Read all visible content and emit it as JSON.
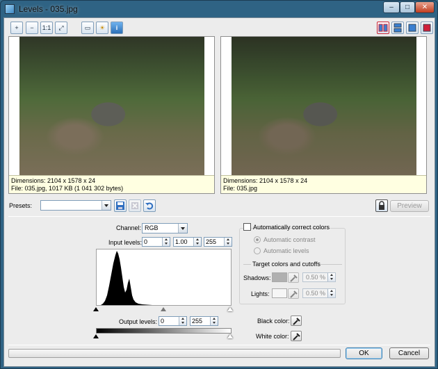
{
  "window": {
    "title": "Levels - 035.jpg",
    "buttons": [
      "–",
      "□",
      "✕"
    ]
  },
  "toolbar": {
    "left": [
      {
        "name": "zoom-in-icon",
        "glyph": "+"
      },
      {
        "name": "zoom-out-icon",
        "glyph": "−"
      },
      {
        "name": "actual-size-icon",
        "glyph": "1:1"
      },
      {
        "name": "fit-window-icon",
        "glyph": "⤢"
      },
      {
        "name": "image-icon",
        "glyph": "▭"
      },
      {
        "name": "highlight-icon",
        "glyph": "☀"
      },
      {
        "name": "info-icon",
        "glyph": "i"
      }
    ],
    "right": [
      {
        "name": "split-vertical-icon"
      },
      {
        "name": "split-horizontal-icon"
      },
      {
        "name": "single-view-icon"
      },
      {
        "name": "original-view-icon"
      }
    ]
  },
  "preview": {
    "left": {
      "dimensions": "Dimensions: 2104 x 1578 x 24",
      "file": "File: 035.jpg, 1017 KB (1 041 302 bytes)"
    },
    "right": {
      "dimensions": "Dimensions: 2104 x 1578 x 24",
      "file": "File: 035.jpg"
    }
  },
  "presets": {
    "label": "Presets:",
    "value": "",
    "preview_button": "Preview"
  },
  "channel": {
    "label": "Channel:",
    "value": "RGB"
  },
  "input_levels": {
    "label": "Input levels:",
    "black": "0",
    "gamma": "1.00",
    "white": "255"
  },
  "output_levels": {
    "label": "Output levels:",
    "black": "0",
    "white": "255"
  },
  "auto": {
    "checkbox_label": "Automatically correct colors",
    "contrast_label": "Automatic contrast",
    "levels_label": "Automatic levels",
    "target_label": "Target colors and cutoffs",
    "shadows_label": "Shadows:",
    "shadows_value": "0.50 %",
    "lights_label": "Lights:",
    "lights_value": "0.50 %"
  },
  "colors": {
    "black_label": "Black color:",
    "white_label": "White color:"
  },
  "footer": {
    "ok": "OK",
    "cancel": "Cancel"
  }
}
